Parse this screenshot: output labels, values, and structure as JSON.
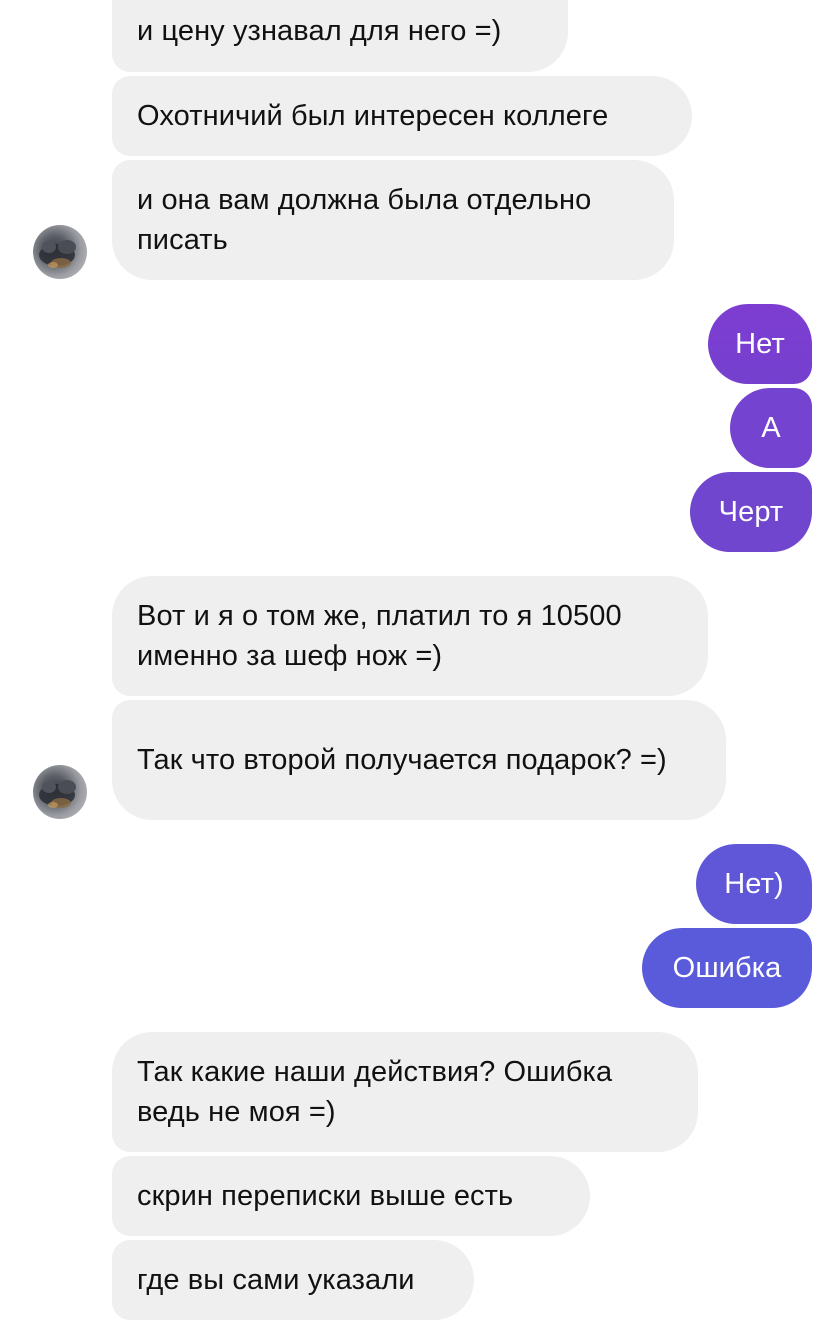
{
  "colors": {
    "incoming_bg": "#efefef",
    "incoming_text": "#111111",
    "outgoing_purple": "#7a3fd0",
    "outgoing_blue": "#5b5bdc",
    "outgoing_text": "#ffffff"
  },
  "messages": [
    {
      "id": "m1",
      "side": "in",
      "text": "и цену узнавал для него =)"
    },
    {
      "id": "m2",
      "side": "in",
      "text": "Охотничий был интересен коллеге"
    },
    {
      "id": "m3",
      "side": "in",
      "text": "и она вам должна была отдельно писать"
    },
    {
      "id": "m4",
      "side": "out",
      "text": "Нет"
    },
    {
      "id": "m5",
      "side": "out",
      "text": "А"
    },
    {
      "id": "m6",
      "side": "out",
      "text": "Черт"
    },
    {
      "id": "m7",
      "side": "in",
      "text": "Вот и я о том же, платил то я 10500 именно за шеф нож =)"
    },
    {
      "id": "m8",
      "side": "in",
      "text": "Так что второй получается подарок? =)"
    },
    {
      "id": "m9",
      "side": "out",
      "text": "Нет)"
    },
    {
      "id": "m10",
      "side": "out",
      "text": "Ошибка"
    },
    {
      "id": "m11",
      "side": "in",
      "text": "Так какие наши действия? Ошибка ведь не моя =)"
    },
    {
      "id": "m12",
      "side": "in",
      "text": "скрин переписки выше есть"
    },
    {
      "id": "m13",
      "side": "in",
      "text": "где вы сами указали"
    }
  ]
}
